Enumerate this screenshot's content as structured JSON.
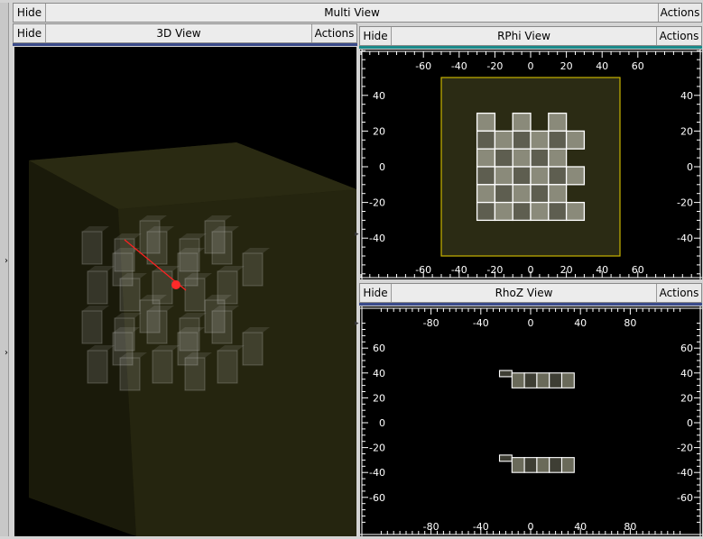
{
  "multi_view": {
    "hide_label": "Hide",
    "title": "Multi View",
    "actions_label": "Actions"
  },
  "view_3d": {
    "hide_label": "Hide",
    "title": "3D View",
    "actions_label": "Actions"
  },
  "rphi_view": {
    "hide_label": "Hide",
    "title": "RPhi View",
    "actions_label": "Actions",
    "x_ticks": [
      "-60",
      "-40",
      "-20",
      "0",
      "20",
      "40",
      "60"
    ],
    "y_ticks": [
      "40",
      "20",
      "0",
      "-20",
      "-40"
    ]
  },
  "rhoz_view": {
    "hide_label": "Hide",
    "title": "RhoZ View",
    "actions_label": "Actions",
    "x_ticks": [
      "-80",
      "-40",
      "0",
      "40",
      "80"
    ],
    "y_ticks": [
      "60",
      "40",
      "20",
      "0",
      "-20",
      "-40",
      "-60"
    ]
  },
  "colors": {
    "active_accent": "#1a8a8a",
    "inactive_accent": "#3a4a8a",
    "box_outline": "#c8b400",
    "track": "#ff2020"
  }
}
